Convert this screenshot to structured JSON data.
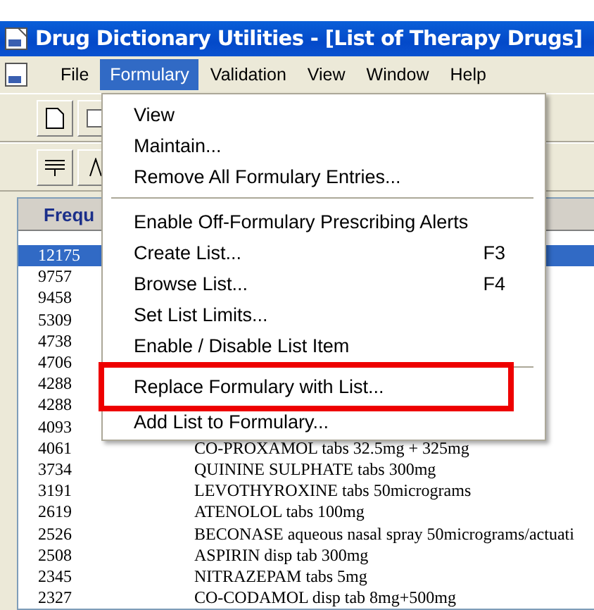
{
  "window": {
    "title": "Drug Dictionary Utilities - [List of Therapy Drugs]"
  },
  "menu_bar": [
    {
      "label": "File",
      "selected": false
    },
    {
      "label": "Formulary",
      "selected": true
    },
    {
      "label": "Validation",
      "selected": false
    },
    {
      "label": "View",
      "selected": false
    },
    {
      "label": "Window",
      "selected": false
    },
    {
      "label": "Help",
      "selected": false
    }
  ],
  "dropdown": [
    {
      "kind": "item",
      "label": "View"
    },
    {
      "kind": "item",
      "label": "Maintain..."
    },
    {
      "kind": "item",
      "label": "Remove All Formulary Entries..."
    },
    {
      "kind": "separator"
    },
    {
      "kind": "item",
      "label": "Enable Off-Formulary Prescribing Alerts"
    },
    {
      "kind": "item",
      "label": "Create List...",
      "shortcut": "F3"
    },
    {
      "kind": "item",
      "label": "Browse List...",
      "shortcut": "F4"
    },
    {
      "kind": "item",
      "label": "Set List Limits..."
    },
    {
      "kind": "item",
      "label": "Enable / Disable List Item"
    },
    {
      "kind": "separator"
    },
    {
      "kind": "item",
      "label": "Replace Formulary with List...",
      "highlighted": true
    },
    {
      "kind": "item",
      "label": "Add List to Formulary..."
    }
  ],
  "table": {
    "columns": [
      "Frequ"
    ],
    "rows": [
      {
        "frequency": "12175",
        "selected": true
      },
      {
        "frequency": "9757",
        "selected": false
      },
      {
        "frequency": "9458",
        "selected": false
      },
      {
        "frequency": "5309",
        "selected": false
      },
      {
        "frequency": "4738",
        "selected": false
      },
      {
        "frequency": "4706",
        "selected": false
      },
      {
        "frequency": "4288",
        "selected": false
      },
      {
        "frequency": "4288",
        "selected": false
      },
      {
        "frequency": "4093",
        "selected": false
      },
      {
        "frequency": "4061",
        "drug": "CO-PROXAMOL tabs 32.5mg + 325mg",
        "selected": false
      },
      {
        "frequency": "3734",
        "drug": "QUININE SULPHATE tabs 300mg",
        "selected": false
      },
      {
        "frequency": "3191",
        "drug": "LEVOTHYROXINE tabs 50micrograms",
        "selected": false
      },
      {
        "frequency": "2619",
        "drug": "ATENOLOL tabs 100mg",
        "selected": false
      },
      {
        "frequency": "2526",
        "drug": "BECONASE aqueous nasal spray 50micrograms/actuati",
        "selected": false
      },
      {
        "frequency": "2508",
        "drug": "ASPIRIN disp tab 300mg",
        "selected": false
      },
      {
        "frequency": "2345",
        "drug": "NITRAZEPAM tabs 5mg",
        "selected": false
      },
      {
        "frequency": "2327",
        "drug": "CO-CODAMOL disp tab 8mg+500mg",
        "selected": false
      }
    ]
  }
}
